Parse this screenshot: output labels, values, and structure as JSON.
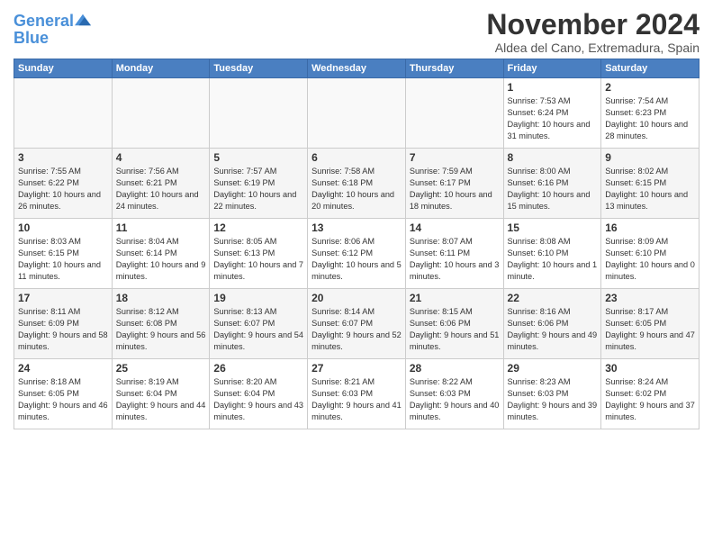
{
  "header": {
    "logo_line1": "General",
    "logo_line2": "Blue",
    "title": "November 2024",
    "subtitle": "Aldea del Cano, Extremadura, Spain"
  },
  "columns": [
    "Sunday",
    "Monday",
    "Tuesday",
    "Wednesday",
    "Thursday",
    "Friday",
    "Saturday"
  ],
  "weeks": [
    [
      {
        "day": "",
        "info": ""
      },
      {
        "day": "",
        "info": ""
      },
      {
        "day": "",
        "info": ""
      },
      {
        "day": "",
        "info": ""
      },
      {
        "day": "",
        "info": ""
      },
      {
        "day": "1",
        "info": "Sunrise: 7:53 AM\nSunset: 6:24 PM\nDaylight: 10 hours and 31 minutes."
      },
      {
        "day": "2",
        "info": "Sunrise: 7:54 AM\nSunset: 6:23 PM\nDaylight: 10 hours and 28 minutes."
      }
    ],
    [
      {
        "day": "3",
        "info": "Sunrise: 7:55 AM\nSunset: 6:22 PM\nDaylight: 10 hours and 26 minutes."
      },
      {
        "day": "4",
        "info": "Sunrise: 7:56 AM\nSunset: 6:21 PM\nDaylight: 10 hours and 24 minutes."
      },
      {
        "day": "5",
        "info": "Sunrise: 7:57 AM\nSunset: 6:19 PM\nDaylight: 10 hours and 22 minutes."
      },
      {
        "day": "6",
        "info": "Sunrise: 7:58 AM\nSunset: 6:18 PM\nDaylight: 10 hours and 20 minutes."
      },
      {
        "day": "7",
        "info": "Sunrise: 7:59 AM\nSunset: 6:17 PM\nDaylight: 10 hours and 18 minutes."
      },
      {
        "day": "8",
        "info": "Sunrise: 8:00 AM\nSunset: 6:16 PM\nDaylight: 10 hours and 15 minutes."
      },
      {
        "day": "9",
        "info": "Sunrise: 8:02 AM\nSunset: 6:15 PM\nDaylight: 10 hours and 13 minutes."
      }
    ],
    [
      {
        "day": "10",
        "info": "Sunrise: 8:03 AM\nSunset: 6:15 PM\nDaylight: 10 hours and 11 minutes."
      },
      {
        "day": "11",
        "info": "Sunrise: 8:04 AM\nSunset: 6:14 PM\nDaylight: 10 hours and 9 minutes."
      },
      {
        "day": "12",
        "info": "Sunrise: 8:05 AM\nSunset: 6:13 PM\nDaylight: 10 hours and 7 minutes."
      },
      {
        "day": "13",
        "info": "Sunrise: 8:06 AM\nSunset: 6:12 PM\nDaylight: 10 hours and 5 minutes."
      },
      {
        "day": "14",
        "info": "Sunrise: 8:07 AM\nSunset: 6:11 PM\nDaylight: 10 hours and 3 minutes."
      },
      {
        "day": "15",
        "info": "Sunrise: 8:08 AM\nSunset: 6:10 PM\nDaylight: 10 hours and 1 minute."
      },
      {
        "day": "16",
        "info": "Sunrise: 8:09 AM\nSunset: 6:10 PM\nDaylight: 10 hours and 0 minutes."
      }
    ],
    [
      {
        "day": "17",
        "info": "Sunrise: 8:11 AM\nSunset: 6:09 PM\nDaylight: 9 hours and 58 minutes."
      },
      {
        "day": "18",
        "info": "Sunrise: 8:12 AM\nSunset: 6:08 PM\nDaylight: 9 hours and 56 minutes."
      },
      {
        "day": "19",
        "info": "Sunrise: 8:13 AM\nSunset: 6:07 PM\nDaylight: 9 hours and 54 minutes."
      },
      {
        "day": "20",
        "info": "Sunrise: 8:14 AM\nSunset: 6:07 PM\nDaylight: 9 hours and 52 minutes."
      },
      {
        "day": "21",
        "info": "Sunrise: 8:15 AM\nSunset: 6:06 PM\nDaylight: 9 hours and 51 minutes."
      },
      {
        "day": "22",
        "info": "Sunrise: 8:16 AM\nSunset: 6:06 PM\nDaylight: 9 hours and 49 minutes."
      },
      {
        "day": "23",
        "info": "Sunrise: 8:17 AM\nSunset: 6:05 PM\nDaylight: 9 hours and 47 minutes."
      }
    ],
    [
      {
        "day": "24",
        "info": "Sunrise: 8:18 AM\nSunset: 6:05 PM\nDaylight: 9 hours and 46 minutes."
      },
      {
        "day": "25",
        "info": "Sunrise: 8:19 AM\nSunset: 6:04 PM\nDaylight: 9 hours and 44 minutes."
      },
      {
        "day": "26",
        "info": "Sunrise: 8:20 AM\nSunset: 6:04 PM\nDaylight: 9 hours and 43 minutes."
      },
      {
        "day": "27",
        "info": "Sunrise: 8:21 AM\nSunset: 6:03 PM\nDaylight: 9 hours and 41 minutes."
      },
      {
        "day": "28",
        "info": "Sunrise: 8:22 AM\nSunset: 6:03 PM\nDaylight: 9 hours and 40 minutes."
      },
      {
        "day": "29",
        "info": "Sunrise: 8:23 AM\nSunset: 6:03 PM\nDaylight: 9 hours and 39 minutes."
      },
      {
        "day": "30",
        "info": "Sunrise: 8:24 AM\nSunset: 6:02 PM\nDaylight: 9 hours and 37 minutes."
      }
    ]
  ]
}
